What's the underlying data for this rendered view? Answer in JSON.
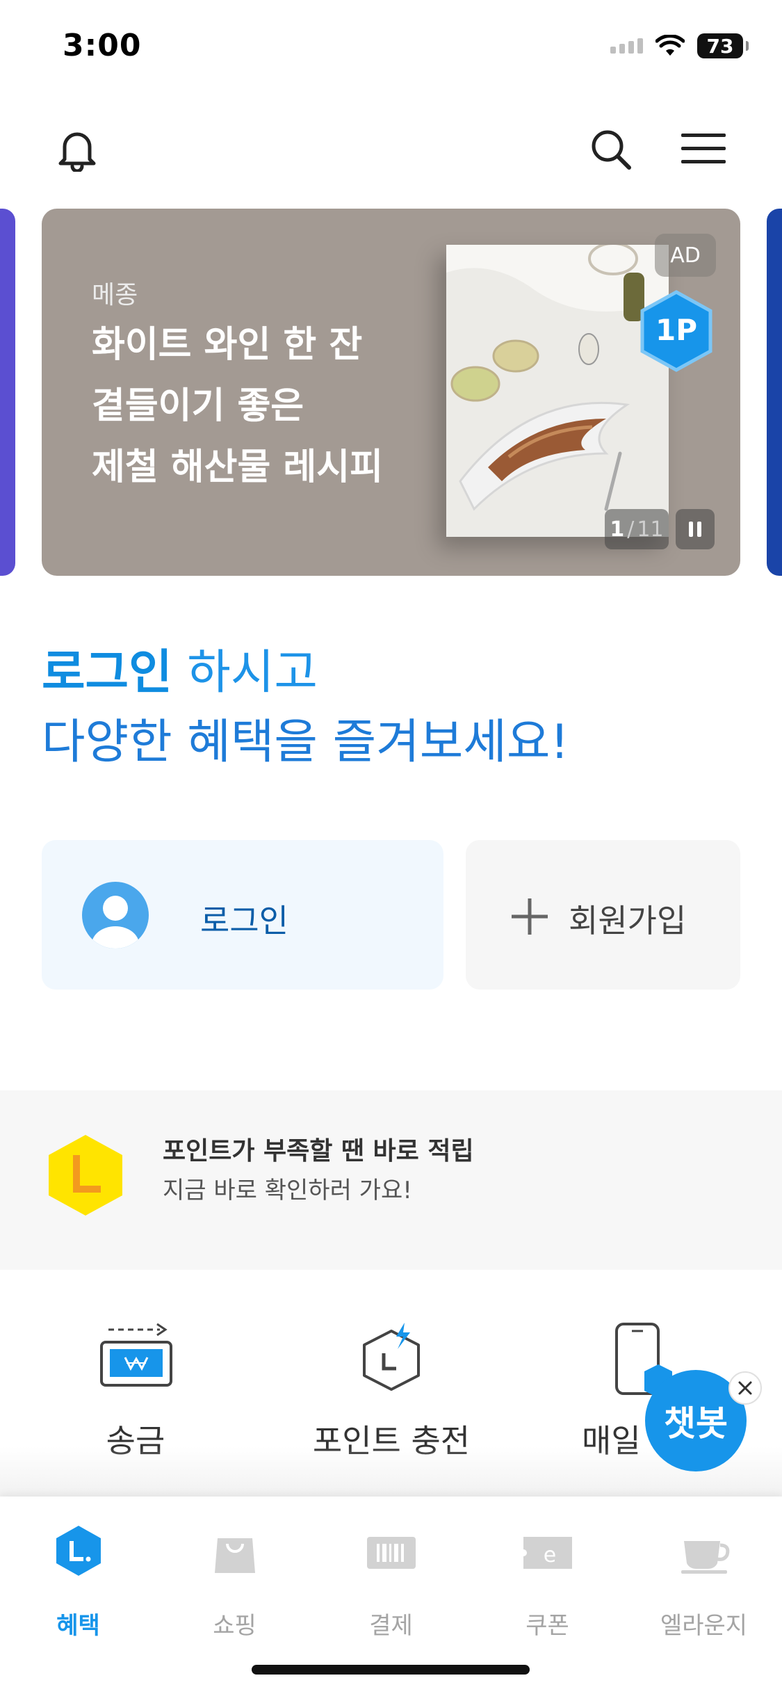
{
  "status_bar": {
    "time": "3:00",
    "battery": "73"
  },
  "banner": {
    "brand": "메종",
    "title_lines": [
      "화이트 와인 한 잔",
      "곁들이기 좋은",
      "제철 해산물 레시피"
    ],
    "ad_label": "AD",
    "point_badge": "1P",
    "counter_current": "1",
    "counter_sep": "/",
    "counter_total": "11"
  },
  "headline": {
    "line1_strong": "로그인",
    "line1_rest": " 하시고",
    "line2": "다양한 혜택을 즐겨보세요!"
  },
  "auth": {
    "login_label": "로그인",
    "signup_label": "회원가입"
  },
  "points_promo": {
    "icon_letter": "L",
    "title": "포인트가 부족할 땐 바로 적립",
    "subtitle": "지금 바로 확인하러 가요!"
  },
  "quick_menu": [
    {
      "label": "송금",
      "icon": "money-transfer-icon"
    },
    {
      "label": "포인트 충전",
      "icon": "point-charge-icon"
    },
    {
      "label": "매일",
      "icon": "phone-daily-icon"
    }
  ],
  "chatbot": {
    "label": "챗봇"
  },
  "tabs": [
    {
      "label": "혜택",
      "icon": "benefit-l-icon",
      "active": true
    },
    {
      "label": "쇼핑",
      "icon": "shopping-bag-icon",
      "active": false
    },
    {
      "label": "결제",
      "icon": "barcode-icon",
      "active": false
    },
    {
      "label": "쿠폰",
      "icon": "coupon-icon",
      "active": false
    },
    {
      "label": "엘라운지",
      "icon": "coffee-cup-icon",
      "active": false
    }
  ],
  "colors": {
    "accent": "#1795ea",
    "headline_blue": "#0f8ce0",
    "banner_bg": "#a39a93",
    "points_yellow": "#ffe400",
    "points_orange": "#f39a1e"
  }
}
